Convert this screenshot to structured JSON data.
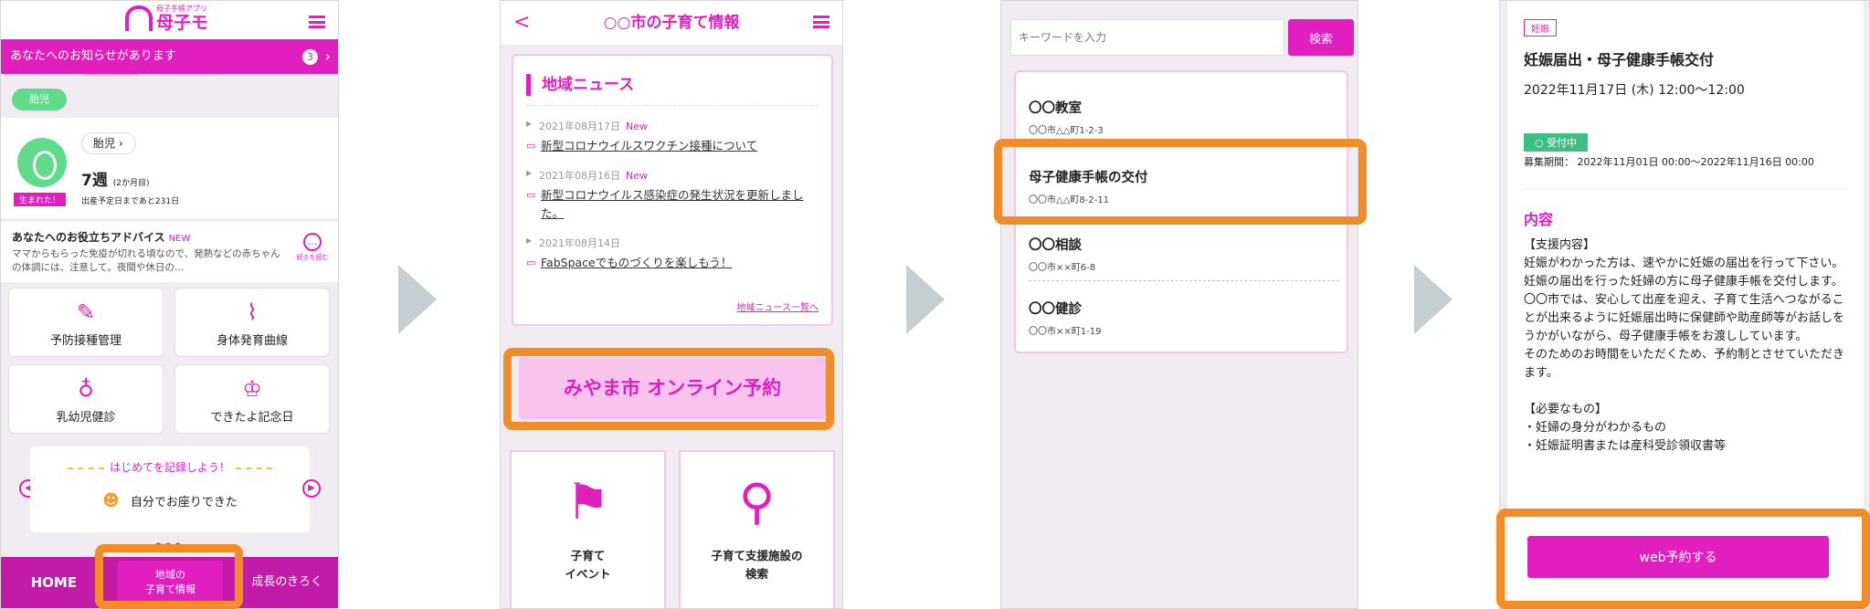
{
  "screen1": {
    "logo_sub": "母子手帳アプリ",
    "logo_text": "母子モ",
    "notice": "あなたへのお知らせがあります",
    "notice_count": "3",
    "chip": "胎児",
    "baby_born": "生まれた！",
    "baby_name": "胎児",
    "baby_week": "7週",
    "baby_week_sub": "(2か月目)",
    "baby_due": "出産予定日まであと231日",
    "advice_title": "あなたへのお役立ちアドバイス",
    "advice_new": "NEW",
    "advice_body": "ママからもらった免疫が切れる頃なので、発熱などの赤ちゃんの体調には、注意して。夜間や休日の…",
    "advice_more": "続きを読む",
    "tiles": [
      "予防接種管理",
      "身体発育曲線",
      "乳幼児健診",
      "できたよ記念日"
    ],
    "record_head": "はじめてを記録しよう！",
    "record_body": "自分でお座りできた",
    "nav": {
      "home": "HOME",
      "local_1": "地域の",
      "local_2": "子育て情報",
      "growth": "成長のきろく"
    }
  },
  "screen2": {
    "title": "○○市の子育て情報",
    "news_title": "地域ニュース",
    "news": [
      {
        "date": "2021年08月17日",
        "new": "New",
        "text": "新型コロナウイルスワクチン接種について"
      },
      {
        "date": "2021年08月16日",
        "new": "New",
        "text": "新型コロナウイルス感染症の発生状況を更新しました。"
      },
      {
        "date": "2021年08月14日",
        "new": "",
        "text": "FabSpaceでものづくりを楽しもう！"
      }
    ],
    "news_more": "地域ニュース一覧へ",
    "banner": "みやま市 オンライン予約",
    "tiles": [
      {
        "line1": "子育て",
        "line2": "イベント"
      },
      {
        "line1": "子育て支援施設の",
        "line2": "検索"
      }
    ]
  },
  "screen3": {
    "search_placeholder": "キーワードを入力",
    "search_button": "検索",
    "items": [
      {
        "name": "〇〇教室",
        "addr": "〇〇市△△町1-2-3"
      },
      {
        "name": "母子健康手帳の交付",
        "addr": "〇〇市△△町8-2-11"
      },
      {
        "name": "〇〇相談",
        "addr": "〇〇市××町6-8"
      },
      {
        "name": "〇〇健診",
        "addr": "〇〇市××町1-19"
      }
    ]
  },
  "screen4": {
    "tag": "妊娠",
    "title": "妊娠届出・母子健康手帳交付",
    "date": "2022年11月17日 (木) 12:00〜12:00",
    "status": "受付中",
    "period": "募集期間： 2022年11月01日 00:00〜2022年11月16日 00:00",
    "heading": "内容",
    "body": [
      "【支援内容】",
      "妊娠がわかった方は、速やかに妊娠の届出を行って下さい。",
      "妊娠の届出を行った妊婦の方に母子健康手帳を交付します。　〇〇市では、安心して出産を迎え、子育て生活へつながることが出来るように妊娠届出時に保健師や助産師等がお話しをうかがいながら、母子健康手帳をお渡ししています。",
      "そのためのお時間をいただくため、予約制とさせていただきます。",
      "",
      "【必要なもの】",
      "・妊婦の身分がわかるもの",
      "・妊娠証明書または産科受診領収書等"
    ],
    "button": "web予約する"
  },
  "colors": {
    "accent": "#e11fbf",
    "highlight": "#f28c28",
    "status": "#3bbf83",
    "arrow": "#c5cfd1"
  }
}
